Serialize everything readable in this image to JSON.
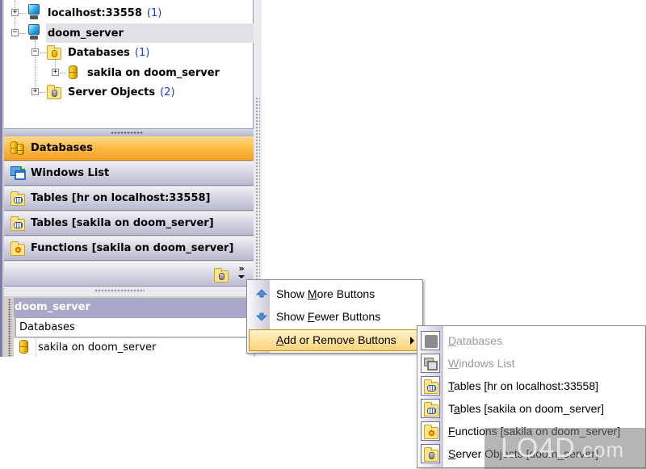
{
  "tree": {
    "nodes": [
      {
        "label": "localhost:33558",
        "count": "(1)",
        "expander": "+"
      },
      {
        "label": "doom_server",
        "count": "",
        "expander": "−"
      },
      {
        "label": "Databases",
        "count": "(1)",
        "expander": "−"
      },
      {
        "label": "sakila on doom_server",
        "count": "",
        "expander": "+"
      },
      {
        "label": "Server Objects",
        "count": "(2)",
        "expander": "+"
      }
    ]
  },
  "nav": {
    "buttons": [
      {
        "label": "Databases",
        "icon": "databases-icon",
        "active": true
      },
      {
        "label": "Windows List",
        "icon": "windows-list-icon",
        "active": false
      },
      {
        "label": "Tables [hr on localhost:33558]",
        "icon": "tables-folder-icon",
        "active": false
      },
      {
        "label": "Tables [sakila on doom_server]",
        "icon": "tables-folder-icon",
        "active": false
      },
      {
        "label": "Functions [sakila on doom_server]",
        "icon": "functions-folder-icon",
        "active": false
      }
    ],
    "overflow_chevron": "»"
  },
  "panel": {
    "header": "doom_server",
    "subheader": "Databases",
    "rows": [
      {
        "label": "sakila on doom_server"
      }
    ]
  },
  "menu": {
    "items": [
      {
        "pre": "Show ",
        "accel": "M",
        "post": "ore Buttons"
      },
      {
        "pre": "Show ",
        "accel": "F",
        "post": "ewer Buttons"
      },
      {
        "pre": "",
        "accel": "A",
        "post": "dd or Remove Buttons",
        "submenu": true
      }
    ]
  },
  "submenu": {
    "items": [
      {
        "pre": "",
        "accel": "D",
        "post": "atabases",
        "enabled": false
      },
      {
        "pre": "",
        "accel": "W",
        "post": "indows List",
        "enabled": false
      },
      {
        "pre": "",
        "accel": "T",
        "post": "ables [hr on localhost:33558]",
        "enabled": true
      },
      {
        "pre": "T",
        "accel": "a",
        "post": "bles [sakila on doom_server]",
        "enabled": true
      },
      {
        "pre": "",
        "accel": "F",
        "post": "unctions [sakila on doom_server]",
        "enabled": true
      },
      {
        "pre": "",
        "accel": "S",
        "post": "erver Objects [doom_server]",
        "enabled": true
      }
    ]
  },
  "watermark": {
    "brand": "LO4D",
    "suffix": ".com"
  }
}
